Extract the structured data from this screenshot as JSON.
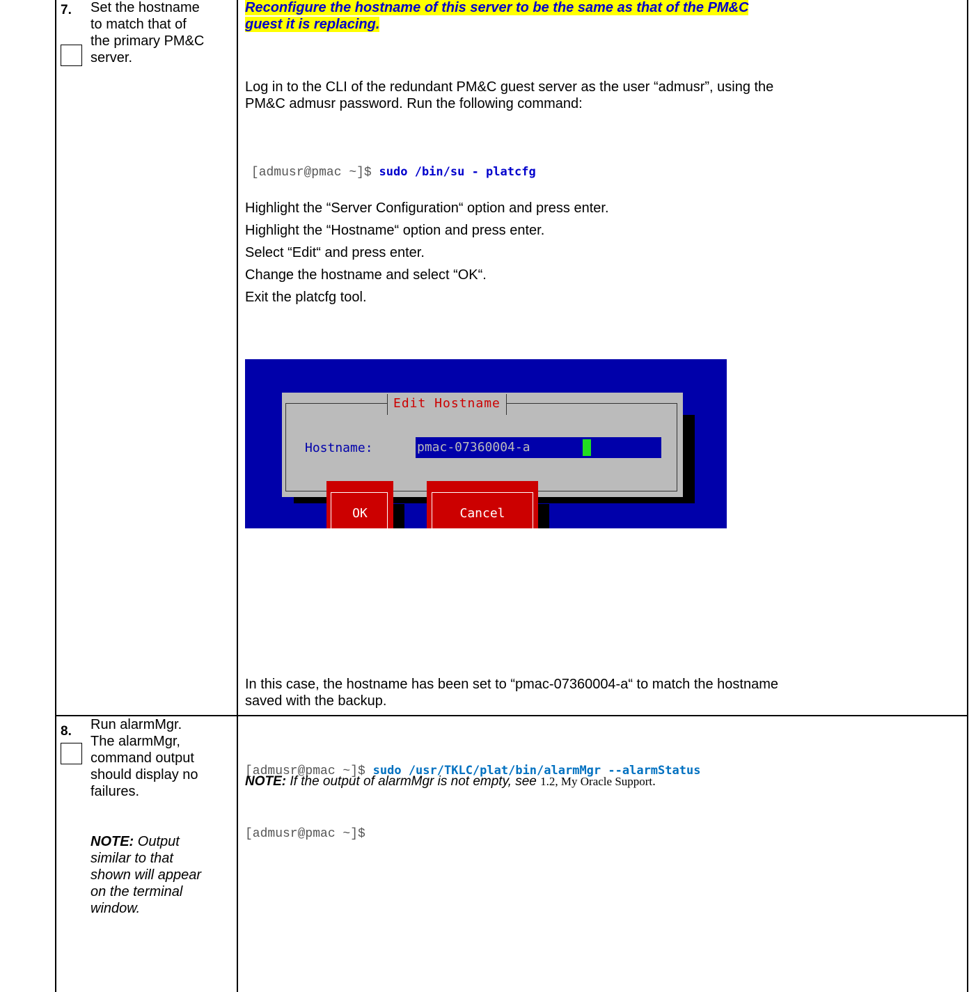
{
  "step7": {
    "number": "7.",
    "title_lines": [
      "Set the hostname",
      "to match that of",
      "the primary PM&C",
      "server."
    ],
    "heading_line1": "Reconfigure the hostname of this server to be the same as that of the PM&C",
    "heading_line2": "guest it is replacing.",
    "login_line1": "Log in to the CLI of the redundant PM&C guest server as the user “admusr”, using the",
    "login_line2": "PM&C admusr password. Run the following command:",
    "prompt": "[admusr@pmac ~]$ ",
    "command": "sudo /bin/su - platcfg",
    "instructions": [
      "Highlight the “Server Configuration“ option and press enter.",
      "Highlight the “Hostname“ option and press enter.",
      "Select “Edit“ and press enter.",
      "Change the hostname and select “OK“.",
      "Exit the platcfg tool."
    ],
    "dialog": {
      "title": "Edit Hostname",
      "field_label": "Hostname:",
      "field_value": "pmac-07360004-a",
      "ok_label": "OK",
      "cancel_label": "Cancel",
      "colors": {
        "background": "#0000aa",
        "dialog": "#bbbbbb",
        "button": "#cc0000",
        "label": "#0000aa",
        "title": "#cc0000",
        "cursor": "#22dd22"
      }
    },
    "result_line1": "In this case, the hostname has been set to “pmac-07360004-a“ to match the hostname",
    "result_line2": "saved with the backup."
  },
  "step8": {
    "number": "8.",
    "title_lines": [
      "Run alarmMgr.",
      "The alarmMgr,",
      "command output",
      "should display no",
      "failures."
    ],
    "note_label": "NOTE:",
    "note_rest": " Output",
    "note_lines": [
      "similar to that",
      "shown will appear",
      "on the terminal",
      "window."
    ],
    "prompt": "[admusr@pmac ~]$ ",
    "command": "sudo /usr/TKLC/plat/bin/alarmMgr --alarmStatus",
    "prompt2": "[admusr@pmac ~]$",
    "note2_label": "NOTE:",
    "note2_text": " If the output of alarmMgr is not empty, see ",
    "note2_ref": "1.2, My Oracle Support",
    "note2_end": "."
  }
}
